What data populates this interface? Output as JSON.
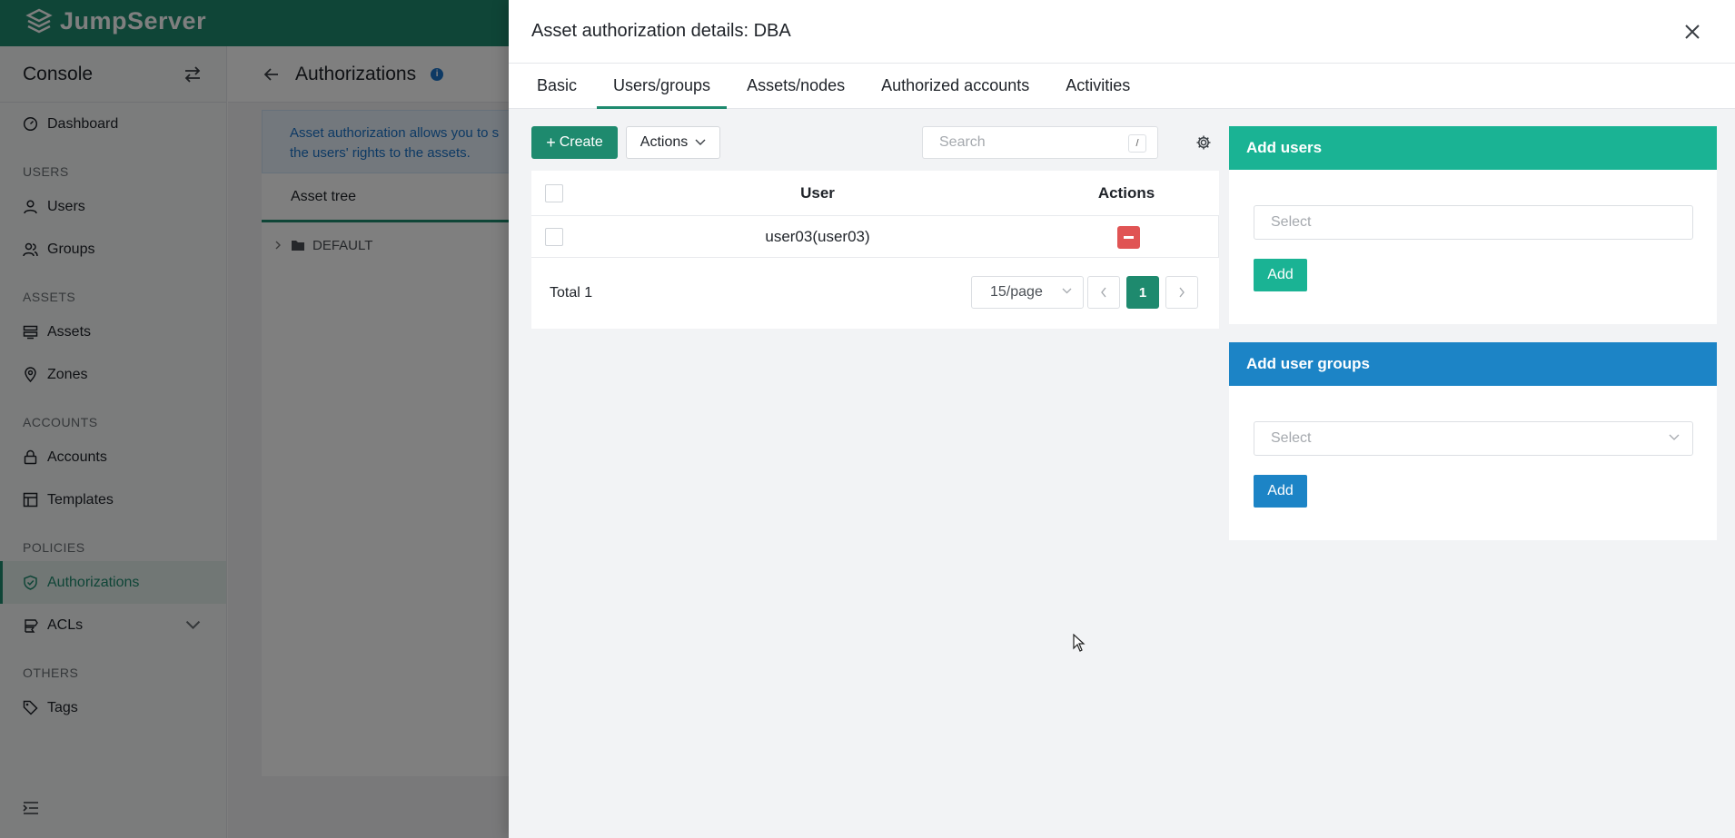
{
  "app": {
    "brand": "JumpServer"
  },
  "sidebar": {
    "console_label": "Console",
    "items": [
      {
        "type": "item",
        "label": "Dashboard",
        "icon": "dashboard-icon"
      },
      {
        "type": "section",
        "label": "USERS"
      },
      {
        "type": "item",
        "label": "Users",
        "icon": "user-icon"
      },
      {
        "type": "item",
        "label": "Groups",
        "icon": "group-icon"
      },
      {
        "type": "section",
        "label": "ASSETS"
      },
      {
        "type": "item",
        "label": "Assets",
        "icon": "assets-icon"
      },
      {
        "type": "item",
        "label": "Zones",
        "icon": "location-icon"
      },
      {
        "type": "section",
        "label": "ACCOUNTS"
      },
      {
        "type": "item",
        "label": "Accounts",
        "icon": "lock-icon"
      },
      {
        "type": "item",
        "label": "Templates",
        "icon": "template-icon"
      },
      {
        "type": "section",
        "label": "POLICIES"
      },
      {
        "type": "item",
        "label": "Authorizations",
        "icon": "shield-icon",
        "active": true
      },
      {
        "type": "item",
        "label": "ACLs",
        "icon": "acl-icon",
        "expandable": true
      },
      {
        "type": "section",
        "label": "OTHERS"
      },
      {
        "type": "item",
        "label": "Tags",
        "icon": "tag-icon"
      }
    ]
  },
  "main": {
    "title": "Authorizations",
    "notice_line1": "Asset authorization allows you to s",
    "notice_line2": "the users' rights to the assets.",
    "tree_header": "Asset tree",
    "tree_root": "DEFAULT"
  },
  "drawer": {
    "title": "Asset authorization details: DBA",
    "tabs": [
      {
        "label": "Basic",
        "active": false
      },
      {
        "label": "Users/groups",
        "active": true
      },
      {
        "label": "Assets/nodes",
        "active": false
      },
      {
        "label": "Authorized accounts",
        "active": false
      },
      {
        "label": "Activities",
        "active": false
      }
    ],
    "toolbar": {
      "create_label": "Create",
      "actions_label": "Actions",
      "search_placeholder": "Search",
      "search_shortcut": "/"
    },
    "table": {
      "columns": {
        "user": "User",
        "actions": "Actions"
      },
      "rows": [
        {
          "user": "user03(user03)"
        }
      ]
    },
    "pager": {
      "total": "Total 1",
      "page_size": "15/page",
      "current_page": "1"
    },
    "add_users": {
      "title": "Add users",
      "placeholder": "Select",
      "button": "Add"
    },
    "add_user_groups": {
      "title": "Add user groups",
      "placeholder": "Select",
      "button": "Add"
    }
  },
  "colors": {
    "brand_green": "#1e8a6e",
    "panel_green": "#1ab394",
    "panel_blue": "#1c84c6",
    "danger": "#e05454"
  }
}
